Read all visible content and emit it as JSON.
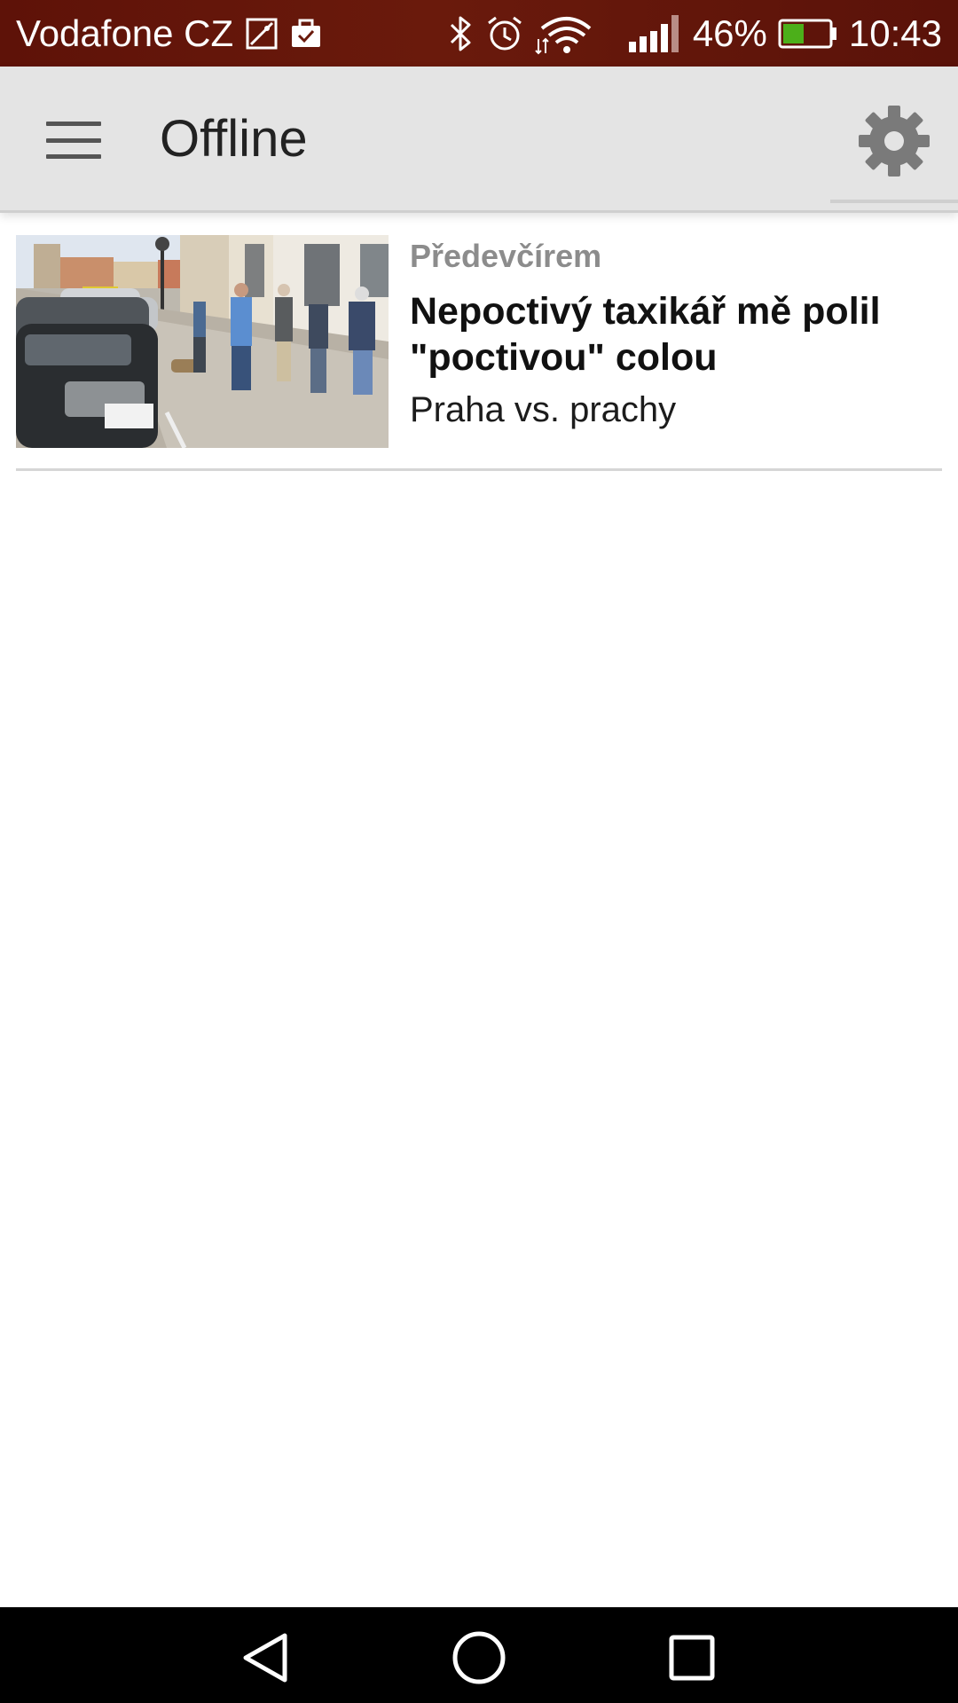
{
  "status_bar": {
    "carrier": "Vodafone CZ",
    "battery_percent": "46%",
    "battery_level": 0.46,
    "time": "10:43",
    "battery_color": "#4caf1a",
    "icons": [
      "gallery-notification-icon",
      "briefcase-notification-icon",
      "bluetooth-icon",
      "alarm-icon",
      "wifi-icon",
      "signal-icon",
      "battery-icon"
    ]
  },
  "app_bar": {
    "title": "Offline",
    "menu_icon": "hamburger-menu-icon",
    "settings_icon": "gear-icon"
  },
  "articles": [
    {
      "date": "Předevčírem",
      "title": "Nepoctivý taxikář mě polil \"poctivou\" colou",
      "section": "Praha vs. prachy",
      "thumbnail": "street-scene-photo"
    }
  ],
  "nav_bar": {
    "icons": [
      "back-triangle-icon",
      "home-circle-icon",
      "recents-square-icon"
    ]
  }
}
